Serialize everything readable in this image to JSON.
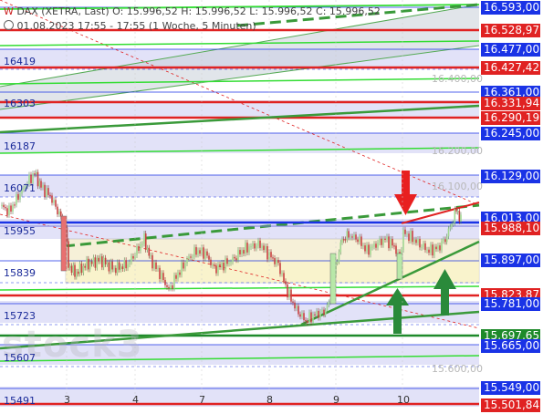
{
  "header": {
    "symbol_icon": "chart-bars-icon",
    "line1": "DAX (XETRA, Last)  O: 15.996,52  H: 15.996,52  L: 15.996,52  C: 15.996,52",
    "line1_symbol": "W",
    "line2": "01.08.2023 17:55 - 17:55   (1 Woche, 5 Minuten)"
  },
  "watermark": "stock3",
  "price_tags": [
    {
      "label": "16.593,00",
      "color": "blue"
    },
    {
      "label": "16.528,97",
      "color": "red"
    },
    {
      "label": "16.477,00",
      "color": "blue"
    },
    {
      "label": "16.427,42",
      "color": "red"
    },
    {
      "label": "16.361,00",
      "color": "blue"
    },
    {
      "label": "16.331,94",
      "color": "red"
    },
    {
      "label": "16.290,19",
      "color": "red"
    },
    {
      "label": "16.245,00",
      "color": "blue"
    },
    {
      "label": "16.129,00",
      "color": "blue"
    },
    {
      "label": "16.013,00",
      "color": "blue"
    },
    {
      "label": "15.988,10",
      "color": "red"
    },
    {
      "label": "15.897,00",
      "color": "blue"
    },
    {
      "label": "15.823,87",
      "color": "red"
    },
    {
      "label": "15.781,00",
      "color": "blue"
    },
    {
      "label": "15.697,65",
      "color": "green"
    },
    {
      "label": "15.665,00",
      "color": "blue"
    },
    {
      "label": "15.549,00",
      "color": "blue"
    },
    {
      "label": "15.501,84",
      "color": "red"
    }
  ],
  "axis_labels": [
    "16.400,00",
    "16.200,00",
    "16.100,00",
    "15.600,00"
  ],
  "zone_labels": [
    "16419",
    "16303",
    "16187",
    "16071",
    "15955",
    "15839",
    "15723",
    "15607",
    "15491"
  ],
  "x_labels": [
    "3",
    "4",
    "7",
    "8",
    "9",
    "10"
  ],
  "colors": {
    "zone_fill": "#e2e2f8",
    "consolidation_fill": "#f6f0d8",
    "support_red": "#e02222",
    "trend_green": "#3a9a3a",
    "bright_green": "#33dd33",
    "price_line": "#1a33e6",
    "candle_up": "#a0d890",
    "candle_down": "#c84040",
    "arrow_red": "#e82020",
    "arrow_green": "#2a8a3a"
  },
  "chart_data": {
    "type": "candlestick",
    "x": [
      "3",
      "4",
      "7",
      "8",
      "9",
      "10"
    ],
    "close_last": 15996.52,
    "resistance_levels": [
      16593,
      16477,
      16361,
      16245,
      16129,
      16013,
      15897,
      15781,
      15665,
      15549
    ],
    "red_levels": [
      16528.97,
      16427.42,
      16331.94,
      16290.19,
      15988.1,
      15823.87,
      15501.84
    ],
    "green_level": 15697.65
  }
}
